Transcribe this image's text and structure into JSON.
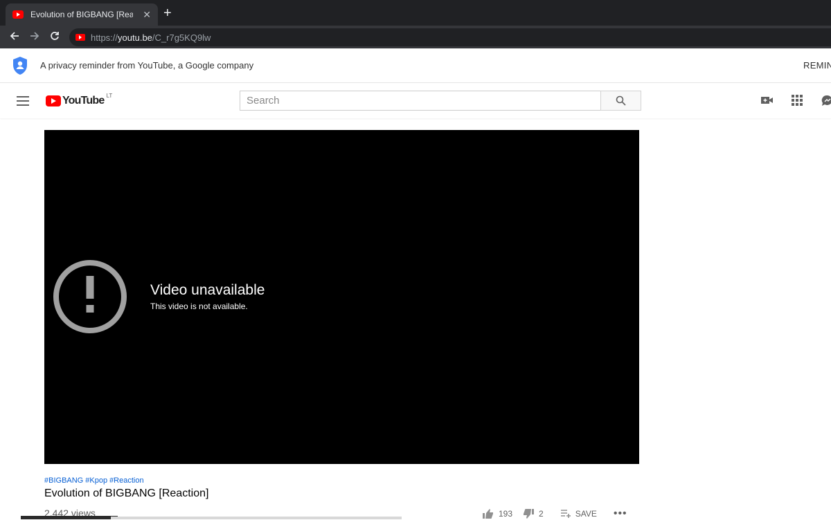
{
  "browser": {
    "tab_title": "Evolution of BIGBANG [Reaction]",
    "tab_close_glyph": "✕",
    "new_tab_glyph": "+",
    "url_scheme": "https://",
    "url_host": "youtu.be",
    "url_path": "/C_r7g5KQ9lw"
  },
  "privacy": {
    "text": "A privacy reminder from YouTube, a Google company",
    "remind_label": "REMIN",
    "icon": "shield-user-icon"
  },
  "masthead": {
    "logo_text": "YouTube",
    "country_code": "LT",
    "search_placeholder": "Search",
    "icons": [
      "menu-icon",
      "create-video-icon",
      "apps-grid-icon",
      "messages-icon"
    ]
  },
  "player": {
    "error_title": "Video unavailable",
    "error_subtitle": "This video is not available."
  },
  "video": {
    "hashtags": [
      "#BIGBANG",
      "#Kpop",
      "#Reaction"
    ],
    "title": "Evolution of BIGBANG [Reaction]",
    "views": "2,442 views",
    "likes": "193",
    "dislikes": "2",
    "save_label": "SAVE",
    "more_glyph": "•••"
  },
  "colors": {
    "youtube_red": "#ff0000",
    "link_blue": "#065fd4",
    "chrome_dark": "#202124",
    "shield_blue": "#4285f4"
  }
}
